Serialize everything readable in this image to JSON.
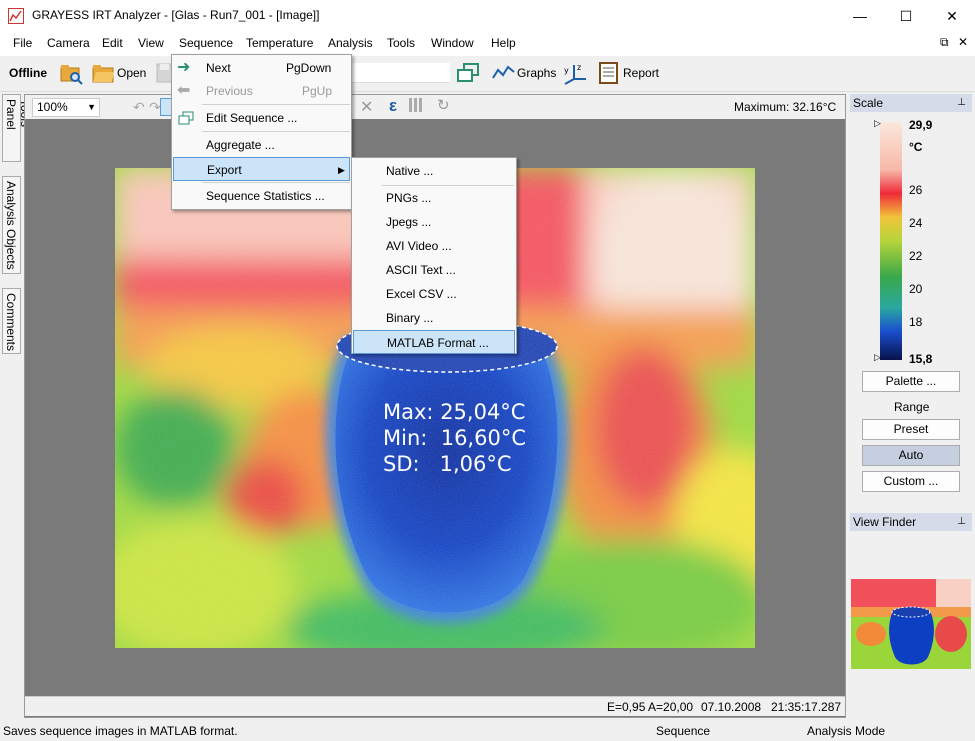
{
  "window": {
    "title": "GRAYESS IRT Analyzer - [Glas - Run7_001 - [Image]]",
    "minimize_glyph": "—",
    "maximize_glyph": "☐",
    "close_glyph": "✕",
    "restore_glyph": "⧉",
    "inner_close_glyph": "✕"
  },
  "menubar": {
    "items": [
      "File",
      "Camera",
      "Edit",
      "View",
      "Sequence",
      "Temperature",
      "Analysis",
      "Tools",
      "Window",
      "Help"
    ]
  },
  "toolbar": {
    "offline_label": "Offline",
    "open_label": "Open",
    "graphs_label": "Graphs",
    "report_label": "Report"
  },
  "side_tabs": [
    "Tools Panel",
    "Analysis Objects",
    "Comments"
  ],
  "image_toolbar": {
    "zoom": "100%",
    "maximum": "Maximum: 32.16°C"
  },
  "sequence_menu": {
    "items": [
      {
        "label": "Next",
        "shortcut": "PgDown"
      },
      {
        "label": "Previous",
        "shortcut": "PgUp"
      },
      {
        "label": "Edit Sequence ..."
      },
      {
        "label": "Aggregate ..."
      },
      {
        "label": "Export"
      },
      {
        "label": "Sequence Statistics ..."
      }
    ]
  },
  "export_menu": {
    "items": [
      "Native ...",
      "PNGs ...",
      "Jpegs ...",
      "AVI Video ...",
      "ASCII Text ...",
      "Excel CSV ...",
      "Binary ...",
      "MATLAB Format ..."
    ]
  },
  "measurement": {
    "max_label": "Max:",
    "max_value": "25,04°C",
    "min_label": "Min:",
    "min_value": "16,60°C",
    "sd_label": "SD:",
    "sd_value": "1,06°C"
  },
  "image_status": {
    "emissivity": "E=0,95 A=20,00",
    "date": "07.10.2008",
    "time": "21:35:17.287"
  },
  "scale": {
    "title": "Scale",
    "max": "29,9",
    "unit": "°C",
    "ticks": [
      "26",
      "24",
      "22",
      "20",
      "18"
    ],
    "min": "15,8",
    "palette_button": "Palette ...",
    "range_label": "Range",
    "preset_button": "Preset",
    "auto_button": "Auto",
    "custom_button": "Custom ..."
  },
  "viewfinder": {
    "title": "View Finder"
  },
  "statusbar": {
    "message": "Saves sequence images in MATLAB format.",
    "context": "Sequence",
    "mode": "Analysis Mode"
  },
  "colors": {
    "highlight": "#cce4f7",
    "highlight_border": "#5a9bd5",
    "panel_header": "#d6dbe9",
    "auto_button": "#c6cfe0"
  }
}
